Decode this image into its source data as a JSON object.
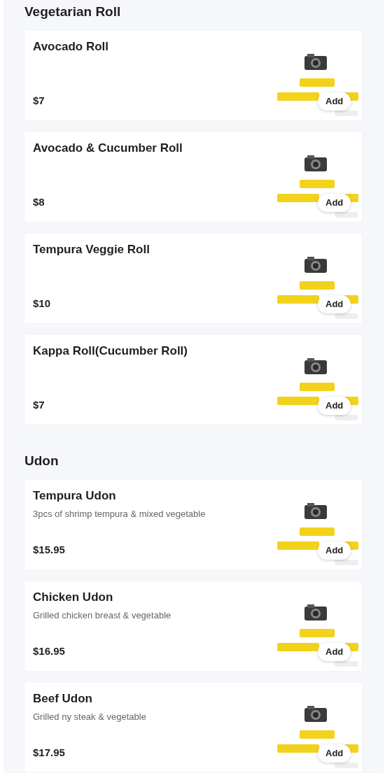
{
  "sections": [
    {
      "title": "Vegetarian Roll",
      "items": [
        {
          "name": "Avocado Roll",
          "price": "$7",
          "button": "Add"
        },
        {
          "name": "Avocado & Cucumber Roll",
          "price": "$8",
          "button": "Add"
        },
        {
          "name": "Tempura Veggie Roll",
          "price": "$10",
          "button": "Add"
        },
        {
          "name": "Kappa Roll(Cucumber Roll)",
          "price": "$7",
          "button": "Add"
        }
      ]
    },
    {
      "title": "Udon",
      "items": [
        {
          "name": "Tempura Udon",
          "description": "3pcs of shrimp tempura & mixed vegetable",
          "price": "$15.95",
          "button": "Add"
        },
        {
          "name": "Chicken Udon",
          "description": "Grilled chicken breast & vegetable",
          "price": "$16.95",
          "button": "Add"
        },
        {
          "name": "Beef Udon",
          "description": "Grilled ny steak & vegetable",
          "price": "$17.95",
          "button": "Add"
        }
      ]
    }
  ]
}
